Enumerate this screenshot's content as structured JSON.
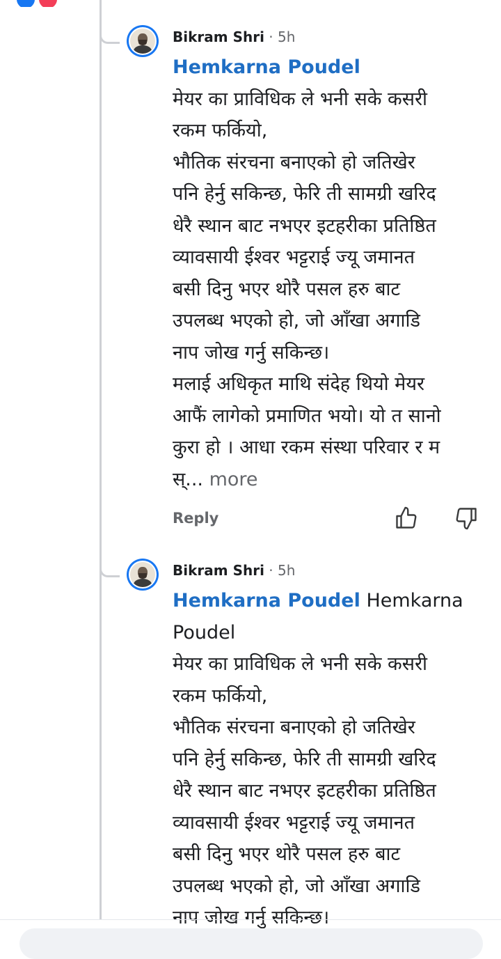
{
  "top_bar": {
    "left_text": "",
    "right_text": ""
  },
  "comments": [
    {
      "author": "Bikram Shri",
      "time": "5h",
      "mention": "Hemkarna Poudel",
      "mention_suffix_lines": [],
      "lines": [
        "मेयर का प्राविधिक ले भनी सके कसरी",
        "रकम फर्कियो,",
        "भौतिक संरचना बनाएको हो जतिखेर",
        "पनि हेर्नु सकिन्छ, फेरि ती सामग्री खरिद",
        "धेरै स्थान बाट नभएर इटहरीका प्रतिष्ठित",
        "व्यावसायी ईश्वर भट्टराई ज्यू जमानत",
        "बसी दिनु भएर थोरै पसल हरु बाट",
        "उपलब्ध भएको हो, जो आँखा अगाडि",
        "नाप जोख गर्नु सकिन्छ।",
        "मलाई अधिकृत माथि संदेह थियो मेयर",
        "आफैं लागेको प्रमाणित भयो। यो त सानो",
        "कुरा हो । आधा रकम संस्था परिवार र म",
        "स्..."
      ],
      "more_label": "more",
      "reply_label": "Reply",
      "like_icon": "thumbs-up-icon",
      "dislike_icon": "thumbs-down-icon"
    },
    {
      "author": "Bikram Shri",
      "time": "5h",
      "mention": "Hemkarna Poudel",
      "mention_suffix_lines": [
        "Hemkarna",
        "Poudel"
      ],
      "lines": [
        "मेयर का प्राविधिक ले भनी सके कसरी",
        "रकम फर्कियो,",
        "भौतिक संरचना बनाएको हो जतिखेर",
        "पनि हेर्नु सकिन्छ, फेरि ती सामग्री खरिद",
        "धेरै स्थान बाट नभएर इटहरीका प्रतिष्ठित",
        "व्यावसायी ईश्वर भट्टराई ज्यू जमानत",
        "बसी दिनु भएर थोरै पसल हरु बाट",
        "उपलब्ध भएको हो, जो आँखा अगाडि",
        "नाप जोख गर्नु सकिन्छ।"
      ]
    }
  ],
  "colors": {
    "mention": "#1f6ec4",
    "muted": "#65676b",
    "thread_line": "#ced0d4",
    "avatar_ring": "#1877f2"
  }
}
